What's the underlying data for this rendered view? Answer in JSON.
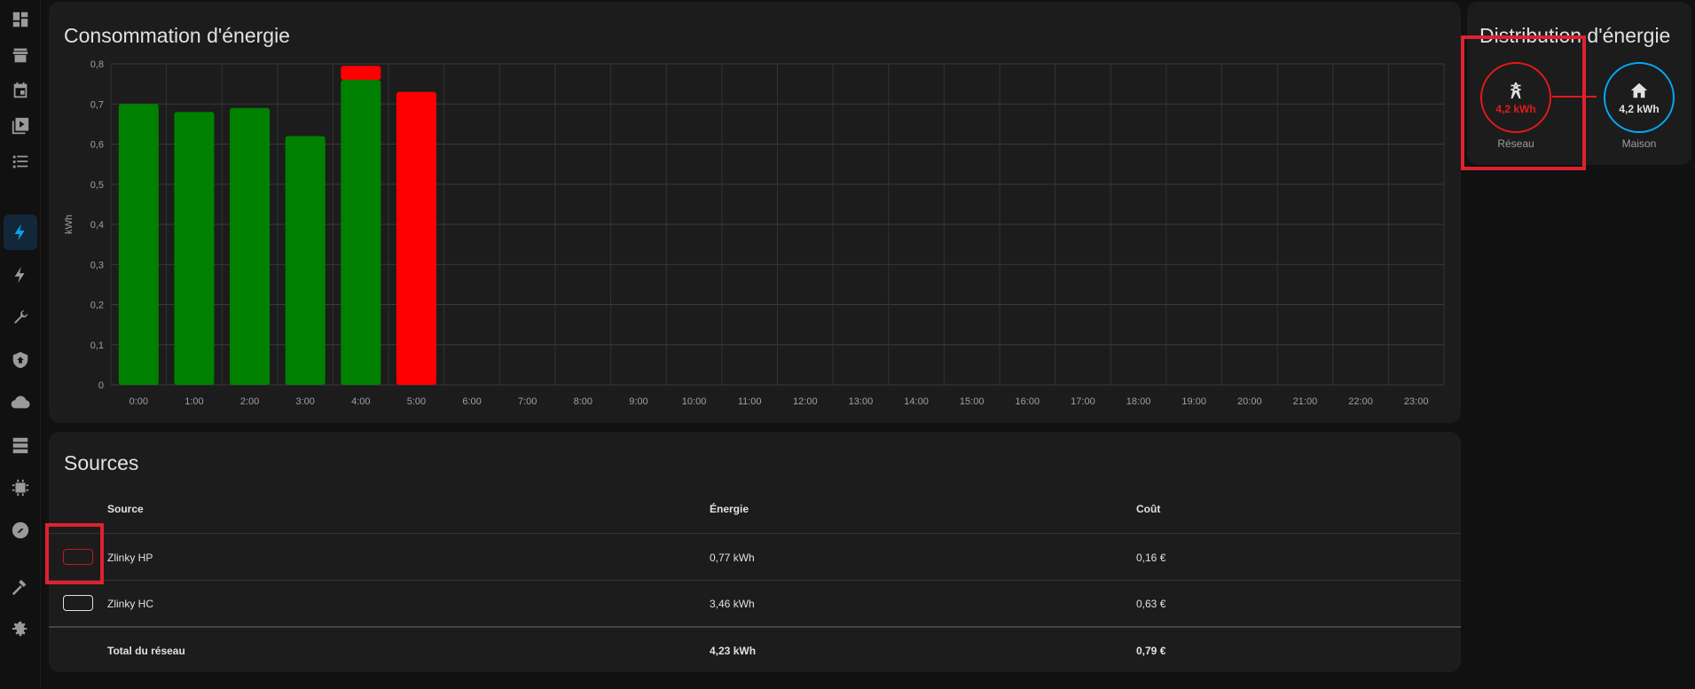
{
  "sidebar": {
    "items": [
      {
        "name": "overview",
        "icon": "dashboard-icon"
      },
      {
        "name": "hacs",
        "icon": "store-icon",
        "label": "HACS"
      },
      {
        "name": "calendar",
        "icon": "calendar-icon"
      },
      {
        "name": "media",
        "icon": "media-icon"
      },
      {
        "name": "todo",
        "icon": "list-icon"
      },
      {
        "name": "energy",
        "icon": "energy-icon",
        "active": true
      },
      {
        "name": "energy-2",
        "icon": "lightning-icon"
      },
      {
        "name": "tools",
        "icon": "wrench-icon"
      },
      {
        "name": "security",
        "icon": "shield-icon"
      },
      {
        "name": "cloud",
        "icon": "cloud-icon"
      },
      {
        "name": "server",
        "icon": "server-icon"
      },
      {
        "name": "chip",
        "icon": "chip-icon"
      },
      {
        "name": "zwave",
        "icon": "zwave-icon"
      },
      {
        "name": "developer",
        "icon": "hammer-icon"
      },
      {
        "name": "settings",
        "icon": "gear-icon"
      }
    ]
  },
  "consumption": {
    "title": "Consommation d'énergie",
    "chart_data": {
      "type": "bar",
      "stacked": true,
      "ylabel": "kWh",
      "ylim": [
        0,
        0.8
      ],
      "yticks": [
        "0",
        "0,1",
        "0,2",
        "0,3",
        "0,4",
        "0,5",
        "0,6",
        "0,7",
        "0,8"
      ],
      "categories": [
        "0:00",
        "1:00",
        "2:00",
        "3:00",
        "4:00",
        "5:00",
        "6:00",
        "7:00",
        "8:00",
        "9:00",
        "10:00",
        "11:00",
        "12:00",
        "13:00",
        "14:00",
        "15:00",
        "16:00",
        "17:00",
        "18:00",
        "19:00",
        "20:00",
        "21:00",
        "22:00",
        "23:00"
      ],
      "series": [
        {
          "color": "#008000",
          "values": [
            0.7,
            0.68,
            0.69,
            0.62,
            0.76,
            0,
            0,
            0,
            0,
            0,
            0,
            0,
            0,
            0,
            0,
            0,
            0,
            0,
            0,
            0,
            0,
            0,
            0,
            0
          ]
        },
        {
          "color": "#ff0000",
          "values": [
            0,
            0,
            0,
            0,
            0.035,
            0.73,
            0,
            0,
            0,
            0,
            0,
            0,
            0,
            0,
            0,
            0,
            0,
            0,
            0,
            0,
            0,
            0,
            0,
            0
          ]
        }
      ],
      "grid": true
    }
  },
  "distribution": {
    "title": "Distribution d'énergie",
    "grid": {
      "value": "4,2 kWh",
      "label": "Réseau",
      "color": "#e21a1a"
    },
    "home": {
      "value": "4,2 kWh",
      "label": "Maison",
      "color": "#03a9f4"
    }
  },
  "sources": {
    "title": "Sources",
    "headers": {
      "source": "Source",
      "energy": "Énergie",
      "cost": "Coût"
    },
    "rows": [
      {
        "swatch_color": "#c21a1a",
        "name": "Zlinky HP",
        "energy": "0,77 kWh",
        "cost": "0,16 €"
      },
      {
        "swatch_color": "#e1e1e1",
        "name": "Zlinky HC",
        "energy": "3,46 kWh",
        "cost": "0,63 €"
      }
    ],
    "total": {
      "name": "Total du réseau",
      "energy": "4,23 kWh",
      "cost": "0,79 €"
    }
  }
}
